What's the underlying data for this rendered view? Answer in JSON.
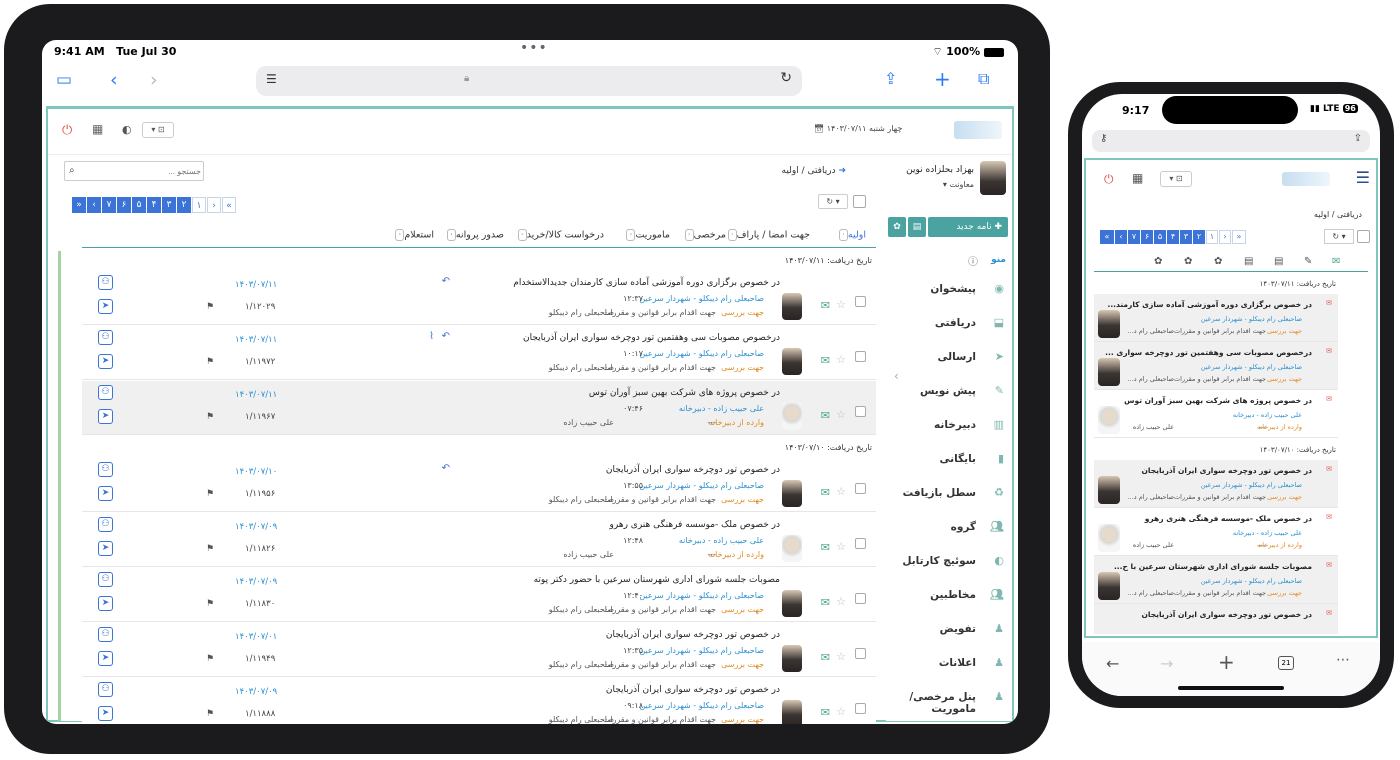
{
  "tablet": {
    "status": {
      "time": "9:41 AM",
      "date": "Tue Jul 30",
      "battery": "100%"
    },
    "header": {
      "date_text": "چهار شنبه ۱۴۰۳/۰۷/۱۱"
    },
    "user": {
      "name": "بهزاد بحلزاده نوین",
      "role": "معاونت"
    },
    "breadcrumb": {
      "root": "دریافتی",
      "current": "اولیه"
    },
    "search": {
      "placeholder": "جستجو ..."
    },
    "pager": {
      "pages": [
        "۷",
        "۶",
        "۵",
        "۴",
        "۳",
        "۲",
        "۱"
      ],
      "first": "«",
      "prev": "‹",
      "next": "›",
      "last": "»"
    },
    "new_letter_label": "نامه جدید",
    "tabs": [
      {
        "label": "اولیه",
        "count": "۰"
      },
      {
        "label": "جهت امضا / پاراف",
        "count": "۰"
      },
      {
        "label": "مرخصی",
        "count": "۰"
      },
      {
        "label": "ماموریت",
        "count": "۰"
      },
      {
        "label": "درخواست کالا/خرید",
        "count": "۰"
      },
      {
        "label": "صدور پروانه",
        "count": "۰"
      },
      {
        "label": "استعلام",
        "count": "۰"
      }
    ],
    "menu_title": "منو",
    "menu": [
      {
        "label": "پیشخوان",
        "icon": "dashboard-icon"
      },
      {
        "label": "دریافتی",
        "icon": "inbox-icon"
      },
      {
        "label": "ارسالی",
        "icon": "send-icon"
      },
      {
        "label": "پیش نویس",
        "icon": "draft-icon"
      },
      {
        "label": "دبیرخانه",
        "icon": "bank-icon"
      },
      {
        "label": "بایگانی",
        "icon": "archive-icon"
      },
      {
        "label": "سطل بازیافت",
        "icon": "recycle-icon"
      },
      {
        "label": "گروه",
        "icon": "group-icon"
      },
      {
        "label": "سوئیچ کارتابل",
        "icon": "toggle-icon"
      },
      {
        "label": "مخاطبین",
        "icon": "contacts-icon"
      },
      {
        "label": "تفویض",
        "icon": "delegate-icon"
      },
      {
        "label": "اعلانات",
        "icon": "announce-icon"
      },
      {
        "label": "پنل مرخصی/ماموریت",
        "icon": "leave-icon"
      }
    ],
    "groups": [
      {
        "label": "تاریخ دریافت: ۱۴۰۳/۰۷/۱۱",
        "rows": [
          {
            "subject": "در خصوص برگزاری دوره آموزشی آماده سازی کارمندان جدیدالاستخدام",
            "from": "صاحبعلی رام دیبکلو - شهردار سرعین",
            "time": "۱۲:۳۷",
            "reason": "جهت بررسی",
            "reason2": "جهت اقدام برابر قوانین و مقررات",
            "cc": "صاحبعلی رام دیبکلو",
            "date": "۱۴۰۳/۰۷/۱۱",
            "num": "۱/۱۲۰۲۹",
            "reply": true,
            "attach": false,
            "avatar": "dark"
          },
          {
            "subject": "درخصوص مصوبات سی وهفتمین تور دوچرخه سواری ایران آذربایجان",
            "from": "صاحبعلی رام دیبکلو - شهردار سرعین",
            "time": "۱۰:۱۷",
            "reason": "جهت بررسی",
            "reason2": "جهت اقدام برابر قوانین و مقررات",
            "cc": "صاحبعلی رام دیبکلو",
            "date": "۱۴۰۳/۰۷/۱۱",
            "num": "۱/۱۱۹۷۲",
            "reply": true,
            "attach": true,
            "avatar": "dark"
          },
          {
            "subject": "در خصوص پروژه های شرکت بهین سبز آوران توس",
            "from": "علی حبیب زاده - دبیرخانه",
            "time": "۰۷:۴۶",
            "reason": "وارده از دبیرخانه",
            "reason2": "---",
            "cc": "علی حبیب زاده",
            "date": "۱۴۰۳/۰۷/۱۱",
            "num": "۱/۱۱۹۶۷",
            "reply": false,
            "attach": false,
            "avatar": "light"
          }
        ]
      },
      {
        "label": "تاریخ دریافت: ۱۴۰۳/۰۷/۱۰",
        "rows": [
          {
            "subject": "در خصوص تور دوچرخه سواری ایران آذربایجان",
            "from": "صاحبعلی رام دیبکلو - شهردار سرعین",
            "time": "۱۳:۵۵",
            "reason": "جهت بررسی",
            "reason2": "جهت اقدام برابر قوانین و مقررات",
            "cc": "صاحبعلی رام دیبکلو",
            "date": "۱۴۰۳/۰۷/۱۰",
            "num": "۱/۱۱۹۵۶",
            "reply": true,
            "attach": false,
            "avatar": "dark"
          },
          {
            "subject": "در خصوص ملک -موسسه فرهنگی هنری رهرو",
            "from": "علی حبیب زاده - دبیرخانه",
            "time": "۱۲:۴۸",
            "reason": "وارده از دبیرخانه",
            "reason2": "---",
            "cc": "علی حبیب زاده",
            "date": "۱۴۰۳/۰۷/۰۹",
            "num": "۱/۱۱۸۲۶",
            "reply": false,
            "attach": false,
            "avatar": "light"
          },
          {
            "subject": "مصوبات جلسه شورای اداری شهرستان سرعین با حضور دکتر پوته",
            "from": "صاحبعلی رام دیبکلو - شهردار سرعین",
            "time": "۱۲:۴۰",
            "reason": "جهت بررسی",
            "reason2": "جهت اقدام برابر قوانین و مقررات",
            "cc": "صاحبعلی رام دیبکلو",
            "date": "۱۴۰۳/۰۷/۰۹",
            "num": "۱/۱۱۸۳۰",
            "reply": false,
            "attach": false,
            "avatar": "dark"
          },
          {
            "subject": "در خصوص تور دوچرخه سواری ایران آذربایجان",
            "from": "صاحبعلی رام دیبکلو - شهردار سرعین",
            "time": "۱۲:۳۵",
            "reason": "جهت بررسی",
            "reason2": "جهت اقدام برابر قوانین و مقررات",
            "cc": "صاحبعلی رام دیبکلو",
            "date": "۱۴۰۳/۰۷/۰۱",
            "num": "۱/۱۱۹۴۹",
            "reply": false,
            "attach": false,
            "avatar": "dark"
          },
          {
            "subject": "در خصوص تور دوچرخه سواری ایران آذربایجان",
            "from": "صاحبعلی رام دیبکلو - شهردار سرعین",
            "time": "۰۹:۱۸",
            "reason": "جهت بررسی",
            "reason2": "جهت اقدام برابر قوانین و مقررات",
            "cc": "صاحبعلی رام دیبکلو",
            "date": "۱۴۰۳/۰۷/۰۹",
            "num": "۱/۱۱۸۸۸",
            "reply": false,
            "attach": false,
            "avatar": "dark"
          }
        ]
      }
    ]
  },
  "phone": {
    "status": {
      "time": "9:17",
      "network": "LTE",
      "battery": "96"
    },
    "breadcrumb": {
      "root": "دریافتی",
      "current": "اولیه"
    },
    "pager": {
      "pages": [
        "۷",
        "۶",
        "۵",
        "۴",
        "۳",
        "۲",
        "۱"
      ]
    },
    "tab_count": "21",
    "groups": [
      {
        "label": "تاریخ دریافت: ۱۴۰۳/۰۷/۱۱",
        "rows": [
          {
            "subject": "در خصوص برگزاری دوره آموزشی آماده سازی کارمند...",
            "from": "صاحبعلی رام دیبکلو - شهردار سرعین",
            "reason": "جهت بررسی",
            "reason2": "جهت اقدام برابر قوانین و مقررات",
            "cc": "صاحبعلی رام د...",
            "avatar": "dark"
          },
          {
            "subject": "درخصوص مصوبات سی وهفتمین تور دوچرخه سواری ...",
            "from": "صاحبعلی رام دیبکلو - شهردار سرعین",
            "reason": "جهت بررسی",
            "reason2": "جهت اقدام برابر قوانین و مقررات",
            "cc": "صاحبعلی رام د...",
            "avatar": "dark"
          },
          {
            "subject": "در خصوص پروژه های شرکت بهین سبز آوران توس",
            "from": "علی حبیب زاده - دبیرخانه",
            "reason": "وارده از دبیرخانه",
            "reason2": "---",
            "cc": "علی حبیب زاده",
            "avatar": "light"
          }
        ]
      },
      {
        "label": "تاریخ دریافت: ۱۴۰۳/۰۷/۱۰",
        "rows": [
          {
            "subject": "در خصوص تور دوچرخه سواری ایران آذربایجان",
            "from": "صاحبعلی رام دیبکلو - شهردار سرعین",
            "reason": "جهت بررسی",
            "reason2": "جهت اقدام برابر قوانین و مقررات",
            "cc": "صاحبعلی رام د...",
            "avatar": "dark"
          },
          {
            "subject": "در خصوص ملک -موسسه فرهنگی هنری رهرو",
            "from": "علی حبیب زاده - دبیرخانه",
            "reason": "وارده از دبیرخانه",
            "reason2": "---",
            "cc": "علی حبیب زاده",
            "avatar": "light"
          },
          {
            "subject": "مصوبات جلسه شورای اداری شهرستان سرعین با ح...",
            "from": "صاحبعلی رام دیبکلو - شهردار سرعین",
            "reason": "جهت بررسی",
            "reason2": "جهت اقدام برابر قوانین و مقررات",
            "cc": "صاحبعلی رام د...",
            "avatar": "dark"
          },
          {
            "subject": "در خصوص تور دوچرخه سواری ایران آذربایجان",
            "from": "",
            "reason": "",
            "reason2": "",
            "cc": "",
            "avatar": "none"
          }
        ]
      }
    ]
  }
}
